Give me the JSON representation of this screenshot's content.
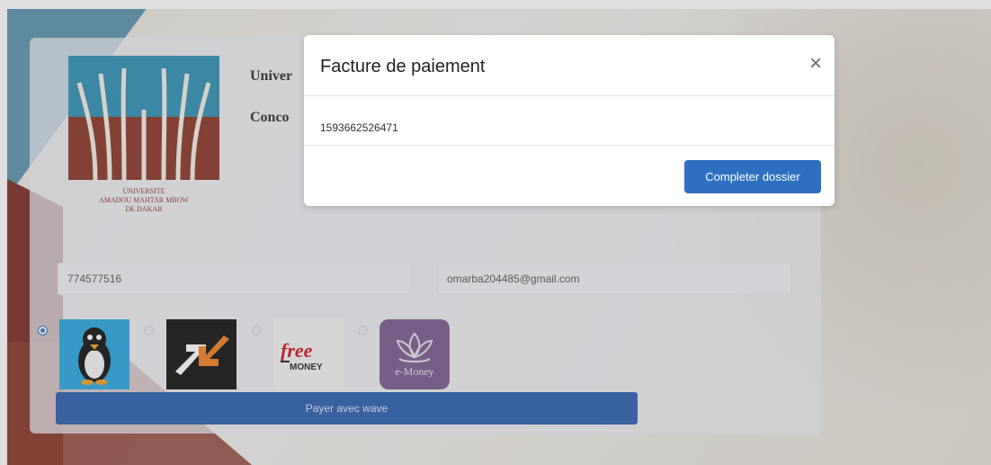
{
  "university": {
    "title": "Univer",
    "subtitle": "Conco",
    "logo_caption_1": "UNIVERSITE",
    "logo_caption_2": "AMADOU MAHTAR MBOW",
    "logo_caption_3": "DE DAKAR"
  },
  "form": {
    "phone_value": "774577516",
    "email_value": "omarba204485@gmail.com",
    "payment_methods": [
      {
        "name": "wave",
        "icon": "wave-penguin-icon",
        "selected": true
      },
      {
        "name": "orange-money",
        "icon": "orange-money-arrows-icon",
        "selected": false
      },
      {
        "name": "free-money",
        "icon": "free-money-logo",
        "selected": false,
        "text_1": "free",
        "text_2": "MONEY"
      },
      {
        "name": "e-money",
        "icon": "e-money-lotus-icon",
        "selected": false,
        "text": "e-Money"
      }
    ],
    "pay_button_label": "Payer avec wave"
  },
  "modal": {
    "title": "Facture de paiement",
    "close_glyph": "×",
    "invoice_number": "1593662526471",
    "complete_button_label": "Completer dossier"
  },
  "colors": {
    "primary_blue": "#2f6fc2",
    "pay_button": "#2c5fb0",
    "logo_red": "#8a3424",
    "logo_blue": "#2f8fb2"
  }
}
